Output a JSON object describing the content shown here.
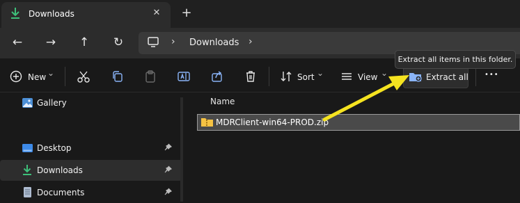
{
  "tab": {
    "title": "Downloads",
    "close_glyph": "✕",
    "new_tab_glyph": "+"
  },
  "nav": {
    "back_glyph": "←",
    "forward_glyph": "→",
    "up_glyph": "↑",
    "refresh_glyph": "↻"
  },
  "address": {
    "segments": [
      "Downloads"
    ],
    "separator": "›"
  },
  "commands": {
    "new_label": "New",
    "sort_label": "Sort",
    "view_label": "View",
    "extract_label": "Extract all",
    "more_glyph": "•••",
    "dropdown_glyph": "⌄"
  },
  "tooltip": {
    "text": "Extract all items in this folder."
  },
  "sidebar": {
    "items": [
      {
        "label": "Gallery",
        "pinned": false,
        "selected": false
      },
      {
        "label": "Desktop",
        "pinned": true,
        "selected": false
      },
      {
        "label": "Downloads",
        "pinned": true,
        "selected": true
      },
      {
        "label": "Documents",
        "pinned": true,
        "selected": false
      }
    ]
  },
  "content": {
    "column_header": "Name",
    "files": [
      {
        "name": "MDRClient-win64-PROD.zip",
        "selected": true
      }
    ]
  },
  "colors": {
    "accent_green": "#3ec07a",
    "arrow_yellow": "#f5e320",
    "folder_yellow": "#f6c343",
    "delete_red": "#e05a5a"
  }
}
